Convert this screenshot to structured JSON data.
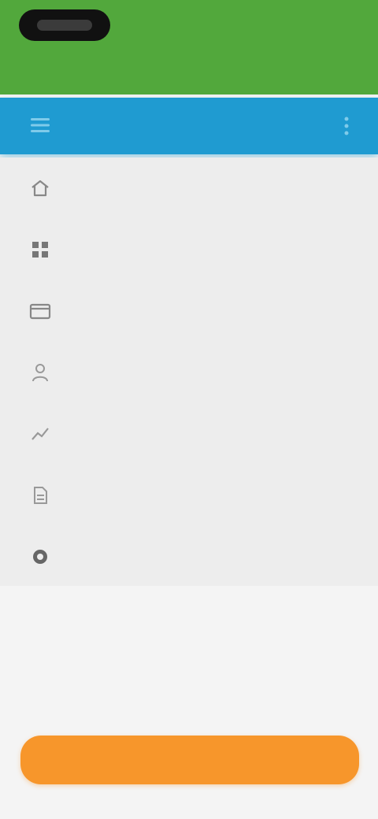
{
  "header": {
    "action_label": "",
    "tabs": [
      {
        "label": ""
      },
      {
        "label": ""
      }
    ]
  },
  "toolbar": {
    "title": "",
    "menu_icon": "menu-icon",
    "right_icon": "more-icon"
  },
  "menu": {
    "items": [
      {
        "label": "",
        "icon": "home-icon"
      },
      {
        "label": "",
        "icon": "grid-icon"
      },
      {
        "label": "",
        "icon": "card-icon"
      },
      {
        "label": "",
        "icon": "person-icon"
      },
      {
        "label": "",
        "icon": "trend-icon"
      },
      {
        "label": "",
        "icon": "document-icon"
      },
      {
        "label": "",
        "icon": "settings-icon"
      }
    ]
  },
  "footer": {
    "button_label": ""
  },
  "colors": {
    "header_green": "#52a83c",
    "toolbar_blue": "#1f9bd1",
    "button_orange": "#f7962b",
    "background": "#f2f2f2"
  }
}
